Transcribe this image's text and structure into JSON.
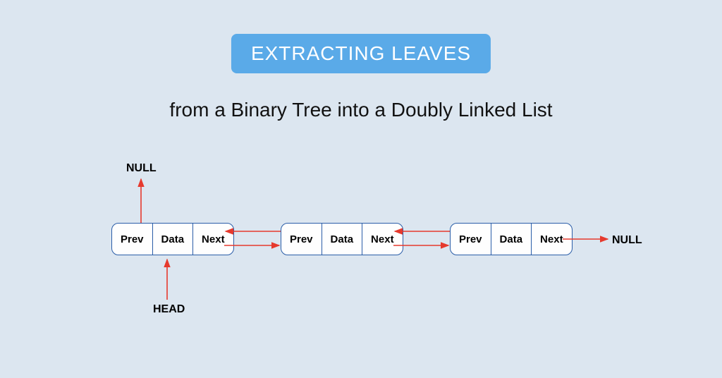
{
  "title_badge": "EXTRACTING LEAVES",
  "subtitle": "from a Binary Tree into a Doubly Linked List",
  "diagram": {
    "null_top": "NULL",
    "null_right": "NULL",
    "head_label": "HEAD",
    "nodes": [
      {
        "prev": "Prev",
        "data": "Data",
        "next": "Next"
      },
      {
        "prev": "Prev",
        "data": "Data",
        "next": "Next"
      },
      {
        "prev": "Prev",
        "data": "Data",
        "next": "Next"
      }
    ],
    "colors": {
      "background": "#dce6f0",
      "badge_bg": "#5aaae8",
      "node_border": "#2a5da8",
      "arrow": "#e63a2e"
    }
  }
}
